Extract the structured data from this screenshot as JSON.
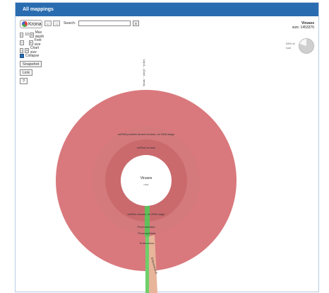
{
  "window": {
    "title": "All mappings"
  },
  "toolbar": {
    "logo_text": "Krona",
    "back_label": "←",
    "forward_label": "→",
    "search_label": "Search:",
    "search_value": "",
    "search_clear_label": "x"
  },
  "settings": {
    "max_depth": {
      "label": "Max depth",
      "value": "10",
      "decrease": "−",
      "increase": "+"
    },
    "font_size": {
      "label": "Font size",
      "value": "",
      "decrease": "−",
      "increase": "+"
    },
    "chart_size": {
      "label": "Chart size",
      "decrease": "−",
      "increase": "+"
    },
    "collapse": {
      "label": "Collapse",
      "checked": true
    },
    "snapshot_label": "Snapshot",
    "link_label": "Link",
    "help_label": "?"
  },
  "selection": {
    "name": "Viruses",
    "size_label": "size: 1453376",
    "percent_label": "93% of root"
  },
  "chart_data": {
    "type": "sunburst",
    "center": {
      "name": "Viruses",
      "sub": "root"
    },
    "labels": {
      "outer_top": "Lily A... (Cad ... virus)",
      "ring1_top": "ssRNA positive-strand viruses, no DNA stage",
      "ring2_top": "ssRNA viruses",
      "ring1_bottom": "ssRNA viruses, no RNA stage",
      "seg1": "Picornavirales",
      "seg2": "Picornaviridae",
      "seg3": "Enterovirus",
      "seg4": "Enterovirus B"
    },
    "colors": {
      "outer": "#d9797d",
      "ring1": "#d26f73",
      "ring2": "#c96468",
      "green": "#6fcf6a",
      "tan": "#e8b49a"
    }
  }
}
